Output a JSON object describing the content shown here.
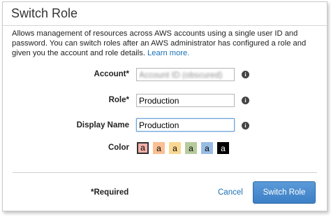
{
  "dialog": {
    "title": "Switch Role",
    "description": "Allows management of resources across AWS accounts using a single user ID and password. You can switch roles after an AWS administrator has configured a role and given you the account and role details.",
    "learn_more": "Learn more."
  },
  "form": {
    "account": {
      "label": "Account*",
      "value": "Account ID (obscured)",
      "info_icon": "info-icon"
    },
    "role": {
      "label": "Role*",
      "value": "Production",
      "info_icon": "info-icon"
    },
    "display_name": {
      "label": "Display Name",
      "value": "Production",
      "info_icon": "info-icon"
    },
    "color": {
      "label": "Color",
      "swatches": [
        {
          "letter": "a",
          "color": "#f2b0a9",
          "selected": true
        },
        {
          "letter": "a",
          "color": "#fbbf93"
        },
        {
          "letter": "a",
          "color": "#fad791"
        },
        {
          "letter": "a",
          "color": "#b7ca9d"
        },
        {
          "letter": "a",
          "color": "#99bce3"
        },
        {
          "letter": "a",
          "color": "#000000",
          "text_color": "#ffffff"
        }
      ]
    }
  },
  "footer": {
    "required_note": "*Required",
    "cancel_label": "Cancel",
    "submit_label": "Switch Role"
  },
  "colors": {
    "accent": "#3d7fc6",
    "link": "#1a6fb5"
  }
}
